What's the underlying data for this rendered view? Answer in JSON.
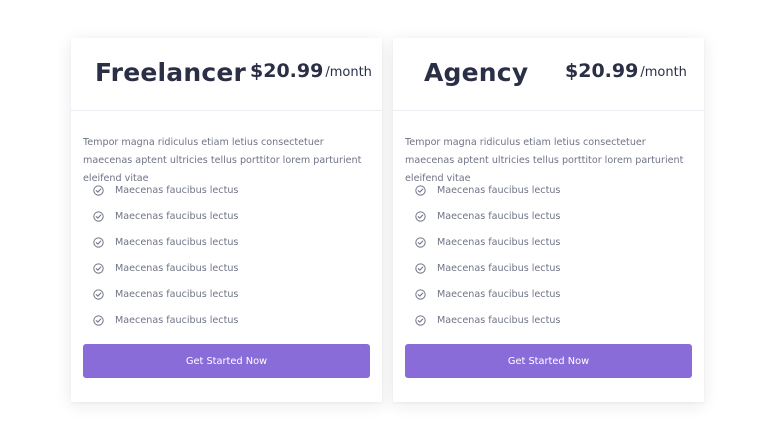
{
  "colors": {
    "button_bg": "#8a6cd9",
    "heading": "#2a2f45",
    "body_text": "#6f7486",
    "check_icon": "#6f7486"
  },
  "plans": [
    {
      "name": "Freelancer",
      "price": "$20.99",
      "period": "/month",
      "description": "Tempor magna ridiculus etiam letius consectetuer maecenas aptent ultricies tellus porttitor lorem parturient eleifend vitae",
      "features": [
        {
          "icon": "check-circle-icon",
          "label": "Maecenas faucibus lectus"
        },
        {
          "icon": "check-circle-icon",
          "label": "Maecenas faucibus lectus"
        },
        {
          "icon": "check-circle-icon",
          "label": "Maecenas faucibus lectus"
        },
        {
          "icon": "check-circle-icon",
          "label": "Maecenas faucibus lectus"
        },
        {
          "icon": "check-circle-icon",
          "label": "Maecenas faucibus lectus"
        },
        {
          "icon": "check-circle-icon",
          "label": "Maecenas faucibus lectus"
        }
      ],
      "cta_label": "Get Started Now"
    },
    {
      "name": "Agency",
      "price": "$20.99",
      "period": "/month",
      "description": "Tempor magna ridiculus etiam letius consectetuer maecenas aptent ultricies tellus porttitor lorem parturient eleifend vitae",
      "features": [
        {
          "icon": "check-circle-icon",
          "label": "Maecenas faucibus lectus"
        },
        {
          "icon": "check-circle-icon",
          "label": "Maecenas faucibus lectus"
        },
        {
          "icon": "check-circle-icon",
          "label": "Maecenas faucibus lectus"
        },
        {
          "icon": "check-circle-icon",
          "label": "Maecenas faucibus lectus"
        },
        {
          "icon": "check-circle-icon",
          "label": "Maecenas faucibus lectus"
        },
        {
          "icon": "check-circle-icon",
          "label": "Maecenas faucibus lectus"
        }
      ],
      "cta_label": "Get Started Now"
    }
  ]
}
